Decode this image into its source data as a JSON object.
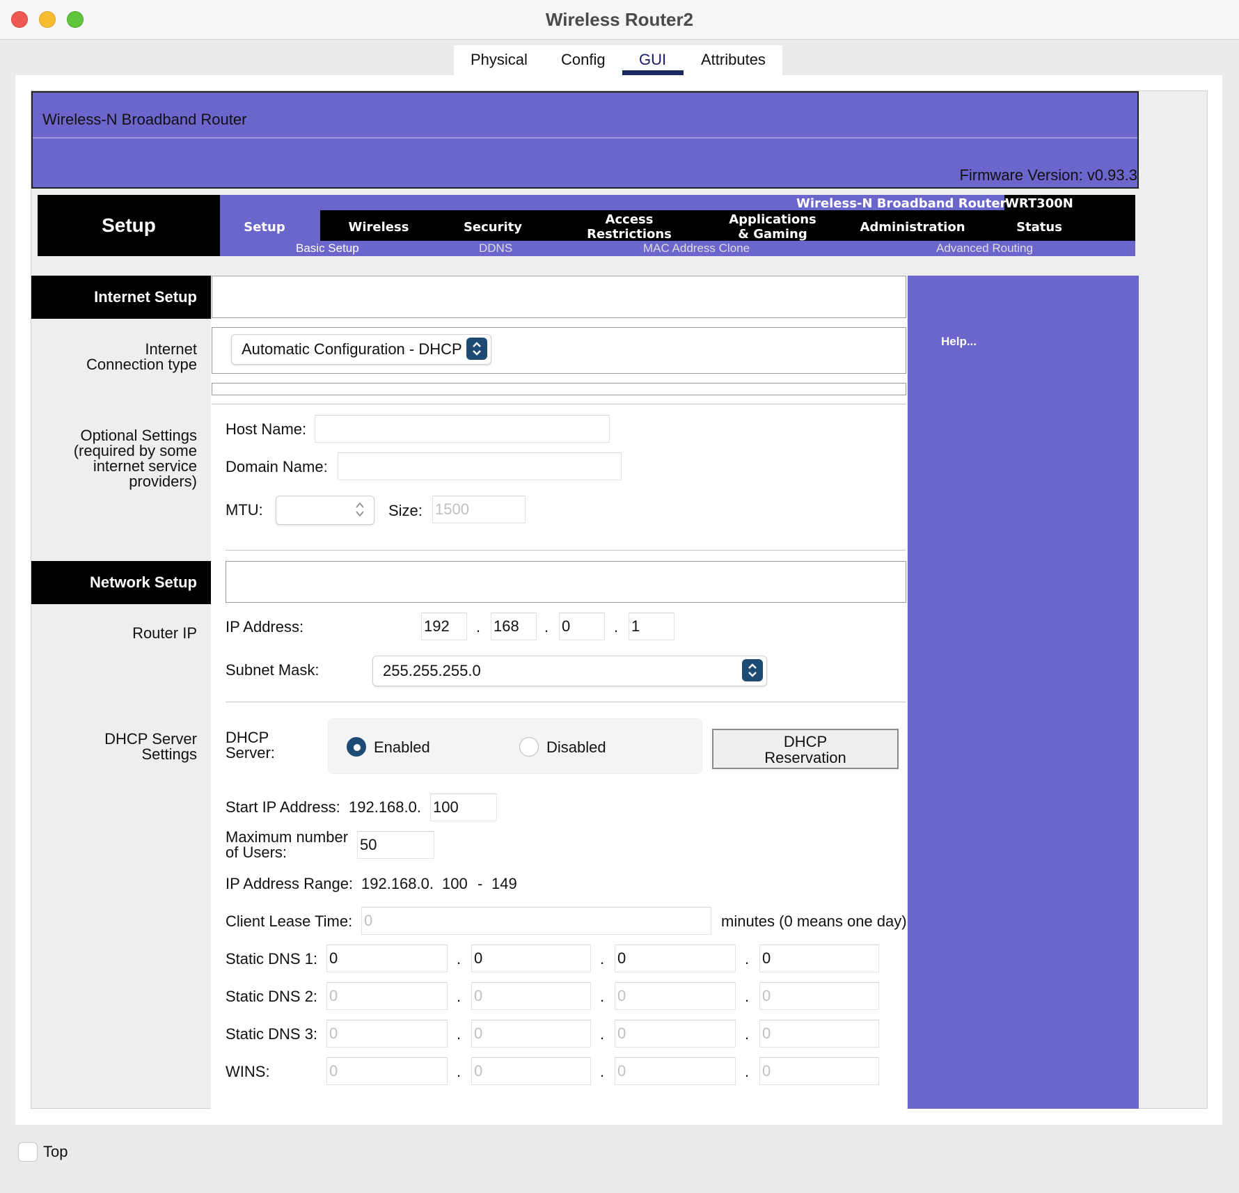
{
  "window": {
    "title": "Wireless Router2"
  },
  "tabs": [
    "Physical",
    "Config",
    "GUI",
    "Attributes"
  ],
  "banner": {
    "brand": "Wireless-N Broadband Router",
    "firmware": "Firmware Version: v0.93.3"
  },
  "nav": {
    "section": "Setup",
    "brand": "Wireless-N Broadband Router",
    "model": "WRT300N",
    "items": [
      "Setup",
      "Wireless",
      "Security",
      "Access\nRestrictions",
      "Applications\n& Gaming",
      "Administration",
      "Status"
    ],
    "subitems": [
      "Basic Setup",
      "DDNS",
      "MAC Address Clone",
      "Advanced Routing"
    ]
  },
  "internet_setup": {
    "heading": "Internet Setup",
    "conn_type_label": "Internet\nConnection type",
    "conn_type_value": "Automatic Configuration - DHCP",
    "optional_label": "Optional Settings\n(required by some\ninternet service\nproviders)",
    "host_name_label": "Host Name:",
    "host_name": "",
    "domain_name_label": "Domain Name:",
    "domain_name": "",
    "mtu_label": "MTU:",
    "mtu_value": "",
    "size_label": "Size:",
    "size_value": "1500"
  },
  "network_setup": {
    "heading": "Network Setup",
    "router_ip_label": "Router IP",
    "ip_label": "IP Address:",
    "ip": [
      "192",
      "168",
      "0",
      "1"
    ],
    "subnet_label": "Subnet Mask:",
    "subnet": "255.255.255.0",
    "dhcp_settings_label": "DHCP Server\nSettings",
    "dhcp_server_label": "DHCP\nServer:",
    "enabled_label": "Enabled",
    "disabled_label": "Disabled",
    "dhcp_enabled": true,
    "reservation_button": "DHCP\nReservation",
    "start_ip_label": "Start IP Address:",
    "start_ip_prefix": "192.168.0.",
    "start_ip_value": "100",
    "max_users_label": "Maximum number\nof Users:",
    "max_users": "50",
    "range_label": "IP Address Range:",
    "range_prefix": "192.168.0.",
    "range_start": "100",
    "range_sep": "-",
    "range_end": "149",
    "lease_label": "Client Lease Time:",
    "lease_value": "0",
    "lease_suffix": "minutes (0 means one day)",
    "dns1_label": "Static DNS 1:",
    "dns1": [
      "0",
      "0",
      "0",
      "0"
    ],
    "dns2_label": "Static DNS 2:",
    "dns2": [
      "0",
      "0",
      "0",
      "0"
    ],
    "dns3_label": "Static DNS 3:",
    "dns3": [
      "0",
      "0",
      "0",
      "0"
    ],
    "wins_label": "WINS:",
    "wins": [
      "0",
      "0",
      "0",
      "0"
    ]
  },
  "help": {
    "link": "Help..."
  },
  "footer": {
    "top_label": "Top",
    "top_checked": false
  },
  "colors": {
    "accent": "#6a66cc",
    "nav_black": "#000000",
    "select_button": "#1e4b74"
  }
}
